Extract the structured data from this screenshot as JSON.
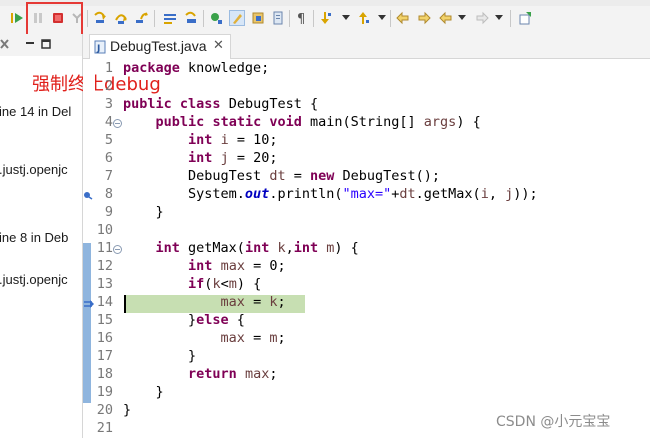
{
  "toolbar": {
    "icons": [
      "resume-icon",
      "suspend-icon",
      "terminate-icon",
      "disconnect-icon",
      "step-into-icon",
      "step-over-icon",
      "step-return-icon",
      "drop-to-frame-icon",
      "use-step-filters-icon",
      "toggle-breakpoint-icon",
      "highlight-icon",
      "open-type-icon",
      "toggle-mark-icon",
      "show-whitespace-icon",
      "next-annotation-icon",
      "previous-annotation-icon",
      "last-edit-icon",
      "back-icon",
      "forward-icon",
      "pin-editor-icon"
    ],
    "colors": {
      "terminate": "#d32f2f",
      "resume": "#3aa14a",
      "accent": "#d9a400"
    }
  },
  "left_view": {
    "lines": [
      "ine 14 in Del",
      ".justj.openjc",
      "ine 8 in Deb",
      ".justj.openjc"
    ]
  },
  "editor": {
    "tab_label": "DebugTest.java",
    "close_glyph": "✕",
    "line_numbers": [
      "1",
      "2",
      "3",
      "4",
      "5",
      "6",
      "7",
      "8",
      "9",
      "10",
      "11",
      "12",
      "13",
      "14",
      "15",
      "16",
      "17",
      "18",
      "19",
      "20",
      "21"
    ]
  },
  "annotation": {
    "text": "强制终止debug",
    "color": "#e0201b"
  },
  "watermark": "CSDN @小元宝宝"
}
